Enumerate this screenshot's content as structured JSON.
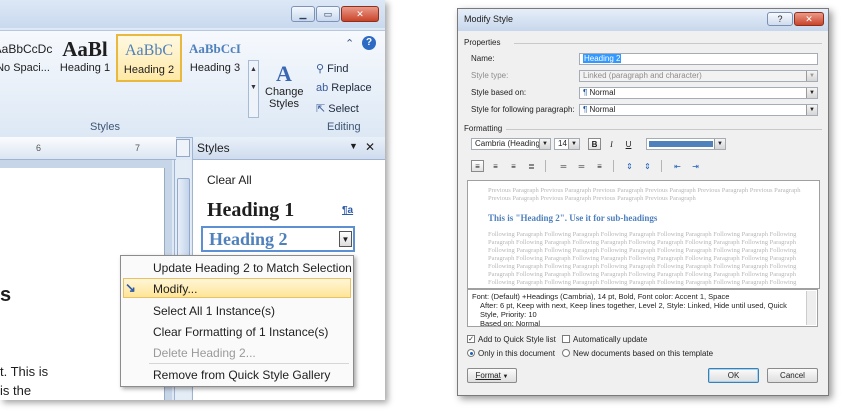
{
  "word": {
    "window_buttons": {
      "minimize": "▁",
      "restore": "▭",
      "close": "✕"
    },
    "help_icon_glyph": "?",
    "collapse_glyph": "⌃",
    "styles_gallery": [
      {
        "preview": "AaBbCcDc",
        "label": "No Spaci..."
      },
      {
        "preview": "AaBl",
        "label": "Heading 1"
      },
      {
        "preview": "AaBbC",
        "label": "Heading 2"
      },
      {
        "preview": "AaBbCcI",
        "label": "Heading 3"
      }
    ],
    "change_styles": {
      "line1": "Change",
      "line2": "Styles"
    },
    "editing": {
      "find": "Find",
      "replace": "Replace",
      "select": "Select"
    },
    "group_labels": {
      "styles": "Styles",
      "editing": "Editing"
    },
    "ruler_marks": {
      "six": "6",
      "seven": "7"
    },
    "doc_text": {
      "heading_fragment": "s",
      "body_line1": "t.  This is",
      "body_line2": "is the"
    },
    "styles_pane": {
      "title": "Styles",
      "clear_all": "Clear All",
      "heading1": "Heading 1",
      "heading1_marker": "¶a",
      "heading2": "Heading 2"
    },
    "context_menu": [
      {
        "label": "Update Heading 2 to Match Selection",
        "disabled": false
      },
      {
        "label": "Modify...",
        "disabled": false,
        "highlighted": true
      },
      {
        "label": "Select All 1 Instance(s)",
        "disabled": false
      },
      {
        "label": "Clear Formatting of 1 Instance(s)",
        "disabled": false
      },
      {
        "label": "Delete Heading 2...",
        "disabled": true
      },
      {
        "label": "Remove from Quick Style Gallery",
        "disabled": false
      }
    ]
  },
  "dialog": {
    "title": "Modify Style",
    "title_buttons": {
      "help": "?",
      "close": "✕"
    },
    "properties_label": "Properties",
    "name_label": "Name:",
    "name_value": "Heading 2",
    "style_type_label": "Style type:",
    "style_type_value": "Linked (paragraph and character)",
    "based_on_label": "Style based on:",
    "based_on_value": "Normal",
    "following_label": "Style for following paragraph:",
    "following_value": "Normal",
    "paragraph_mark": "¶",
    "formatting_label": "Formatting",
    "font_value": "Cambria (Headings)",
    "size_value": "14",
    "bold": "B",
    "italic": "I",
    "underline": "U",
    "font_color": "#4f81bd",
    "preview": {
      "previous": "Previous Paragraph Previous Paragraph Previous Paragraph Previous Paragraph Previous Paragraph Previous Paragraph Previous Paragraph Previous Paragraph Previous Paragraph Previous Paragraph",
      "sample": "This is \"Heading 2\". Use it for sub-headings",
      "following": "Following Paragraph Following Paragraph Following Paragraph Following Paragraph Following Paragraph Following Paragraph Following Paragraph Following Paragraph Following Paragraph Following Paragraph Following Paragraph Following Paragraph Following Paragraph Following Paragraph Following Paragraph Following Paragraph Following Paragraph Following Paragraph Following Paragraph Following Paragraph Following Paragraph Following Paragraph Following Paragraph Following Paragraph Following Paragraph Following Paragraph Following Paragraph Following Paragraph Following Paragraph Following Paragraph Following Paragraph Following Paragraph Following Paragraph Following Paragraph Following Paragraph Following Paragraph Following Paragraph Following Paragraph Following Paragraph Following Paragraph"
    },
    "description": {
      "line1": "Font: (Default) +Headings (Cambria), 14 pt, Bold, Font color: Accent 1, Space",
      "line2": "After:  6 pt, Keep with next, Keep lines together, Level 2, Style: Linked, Hide until used, Quick Style, Priority: 10",
      "line3": "Based on: Normal"
    },
    "add_to_quick": "Add to Quick Style list",
    "auto_update": "Automatically update",
    "only_this_doc": "Only in this document",
    "new_docs": "New documents based on this template",
    "format_button": "Format",
    "ok": "OK",
    "cancel": "Cancel"
  }
}
